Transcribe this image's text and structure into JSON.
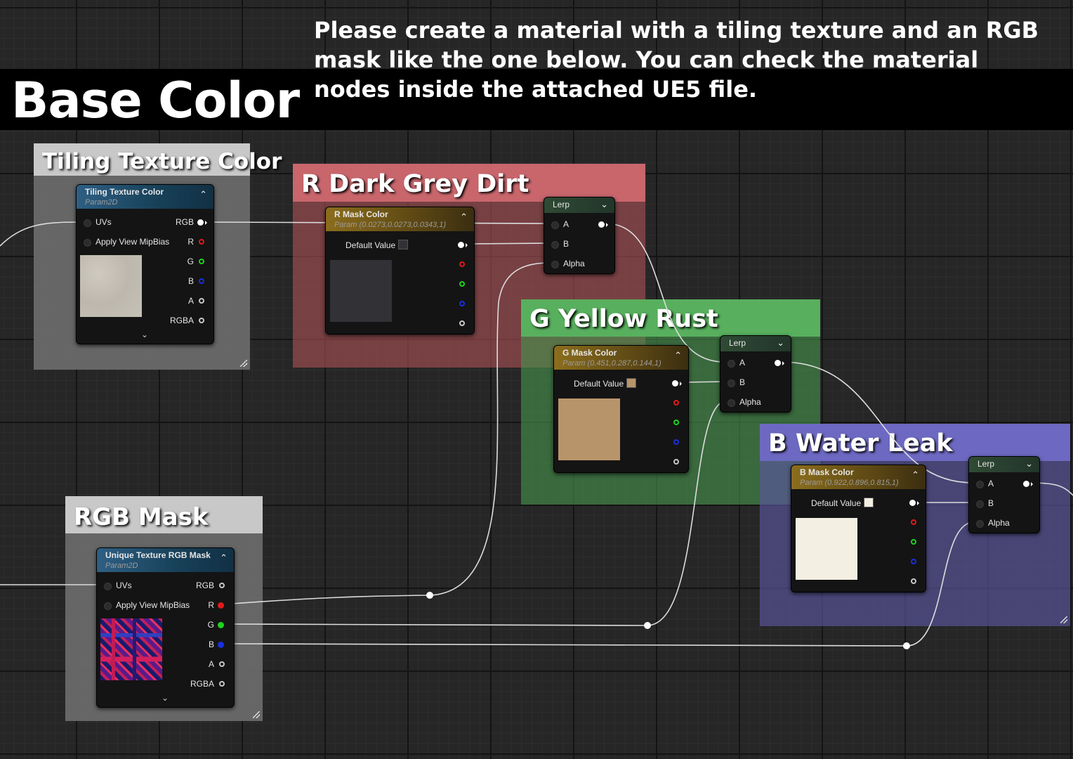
{
  "header": {
    "title": "Base Color",
    "instruction": "Please create a material with a tiling texture and an RGB mask like the one below. You can check the material nodes inside the attached UE5 file."
  },
  "colors": {
    "comment_tiling": "#6a6a6a",
    "comment_rgbmask": "#6a6a6a",
    "comment_r": "#d26f74",
    "comment_g": "#56b45c",
    "comment_b": "#6f6ac8",
    "wire": "#dcdcdc",
    "pin_red": "#e11a1a",
    "pin_green": "#1bd41b",
    "pin_blue": "#1a2fe0",
    "r_param": "#323236",
    "g_param": "#b8946b",
    "b_param": "#f4efe3"
  },
  "comments": {
    "tiling": "Tiling Texture Color",
    "rgbmask": "RGB Mask",
    "r": "R Dark Grey Dirt",
    "g": "G Yellow Rust",
    "b": "B Water Leak"
  },
  "tiling_node": {
    "title": "Tiling Texture Color",
    "subtitle": "Param2D",
    "pin_uvs": "UVs",
    "pin_mipbias": "Apply View MipBias",
    "out_rgb": "RGB",
    "out_r": "R",
    "out_g": "G",
    "out_b": "B",
    "out_a": "A",
    "out_rgba": "RGBA"
  },
  "mask_node": {
    "title": "Unique Texture RGB Mask",
    "subtitle": "Param2D",
    "pin_uvs": "UVs",
    "pin_mipbias": "Apply View MipBias",
    "out_rgb": "RGB",
    "out_r": "R",
    "out_g": "G",
    "out_b": "B",
    "out_a": "A",
    "out_rgba": "RGBA"
  },
  "r_node": {
    "title": "R Mask Color",
    "subtitle": "Param (0.0273,0.0273,0.0343,1)",
    "default": "Default Value"
  },
  "g_node": {
    "title": "G Mask Color",
    "subtitle": "Param (0.451,0.287,0.144,1)",
    "default": "Default Value"
  },
  "b_node": {
    "title": "B Mask Color",
    "subtitle": "Param (0.922,0.896,0.815,1)",
    "default": "Default Value"
  },
  "lerp1": {
    "title": "Lerp",
    "a": "A",
    "b": "B",
    "alpha": "Alpha"
  },
  "lerp2": {
    "title": "Lerp",
    "a": "A",
    "b": "B",
    "alpha": "Alpha"
  },
  "lerp3": {
    "title": "Lerp",
    "a": "A",
    "b": "B",
    "alpha": "Alpha"
  }
}
